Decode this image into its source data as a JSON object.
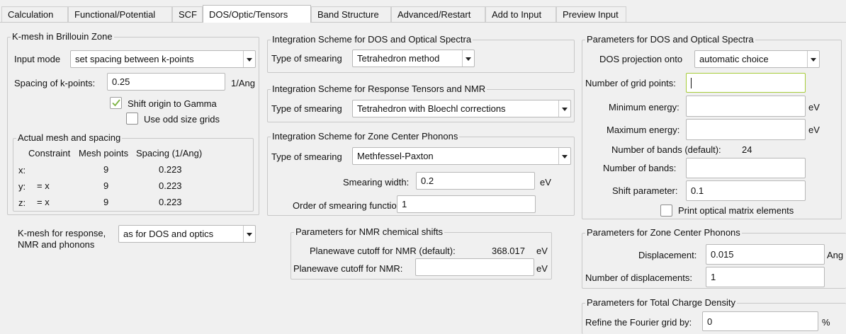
{
  "tabs": [
    {
      "label": "Calculation"
    },
    {
      "label": "Functional/Potential"
    },
    {
      "label": "SCF"
    },
    {
      "label": "DOS/Optic/Tensors"
    },
    {
      "label": "Band Structure"
    },
    {
      "label": "Advanced/Restart"
    },
    {
      "label": "Add to Input"
    },
    {
      "label": "Preview Input"
    }
  ],
  "active_tab": "DOS/Optic/Tensors",
  "kmesh": {
    "title": "K-mesh in Brillouin Zone",
    "input_mode_label": "Input mode",
    "input_mode_value": "set spacing between k-points",
    "spacing_label": "Spacing of k-points:",
    "spacing_value": "0.25",
    "spacing_unit": "1/Ang",
    "shift_origin_label": "Shift origin to Gamma",
    "shift_origin_checked": true,
    "odd_grids_label": "Use odd size grids",
    "odd_grids_checked": false
  },
  "actual_mesh": {
    "title": "Actual mesh and spacing",
    "headers": [
      "Constraint",
      "Mesh points",
      "Spacing (1/Ang)"
    ],
    "rows": [
      {
        "axis": "x:",
        "constraint": "",
        "mesh": "9",
        "spacing": "0.223"
      },
      {
        "axis": "y:",
        "constraint": "= x",
        "mesh": "9",
        "spacing": "0.223"
      },
      {
        "axis": "z:",
        "constraint": "= x",
        "mesh": "9",
        "spacing": "0.223"
      }
    ]
  },
  "response_kmesh": {
    "label_line1": "K-mesh for response,",
    "label_line2": "NMR and phonons",
    "value": "as for DOS and optics"
  },
  "dos_integration": {
    "title": "Integration Scheme for DOS and Optical Spectra",
    "smearing_label": "Type of smearing",
    "smearing_value": "Tetrahedron method"
  },
  "response_integration": {
    "title": "Integration Scheme for Response Tensors and NMR",
    "smearing_label": "Type of smearing",
    "smearing_value": "Tetrahedron with Bloechl corrections"
  },
  "phonon_integration": {
    "title": "Integration Scheme for Zone Center Phonons",
    "smearing_label": "Type of smearing",
    "smearing_value": "Methfessel-Paxton",
    "width_label": "Smearing width:",
    "width_value": "0.2",
    "width_unit": "eV",
    "order_label": "Order of smearing function:",
    "order_value": "1"
  },
  "nmr": {
    "title": "Parameters for NMR chemical shifts",
    "default_label": "Planewave cutoff for NMR (default):",
    "default_value": "368.017",
    "default_unit": "eV",
    "cutoff_label": "Planewave cutoff for NMR:",
    "cutoff_value": "",
    "cutoff_unit": "eV"
  },
  "dos_params": {
    "title": "Parameters for DOS and Optical Spectra",
    "projection_label": "DOS projection onto",
    "projection_value": "automatic choice",
    "grid_points_label": "Number of grid points:",
    "grid_points_value": "",
    "min_energy_label": "Minimum energy:",
    "min_energy_value": "",
    "min_energy_unit": "eV",
    "max_energy_label": "Maximum energy:",
    "max_energy_value": "",
    "max_energy_unit": "eV",
    "bands_default_label": "Number of bands (default):",
    "bands_default_value": "24",
    "bands_label": "Number of bands:",
    "bands_value": "",
    "shift_label": "Shift parameter:",
    "shift_value": "0.1",
    "print_optical_label": "Print optical matrix elements",
    "print_optical_checked": false
  },
  "phonon_params": {
    "title": "Parameters for Zone Center Phonons",
    "displacement_label": "Displacement:",
    "displacement_value": "0.015",
    "displacement_unit": "Ang",
    "num_displacements_label": "Number of displacements:",
    "num_displacements_value": "1"
  },
  "charge_density": {
    "title": "Parameters for Total Charge Density",
    "refine_label": "Refine the Fourier grid by:",
    "refine_value": "0",
    "refine_unit": "%"
  },
  "colors": {
    "focus_border": "#a6cc3a",
    "check_mark": "#7cb342"
  }
}
